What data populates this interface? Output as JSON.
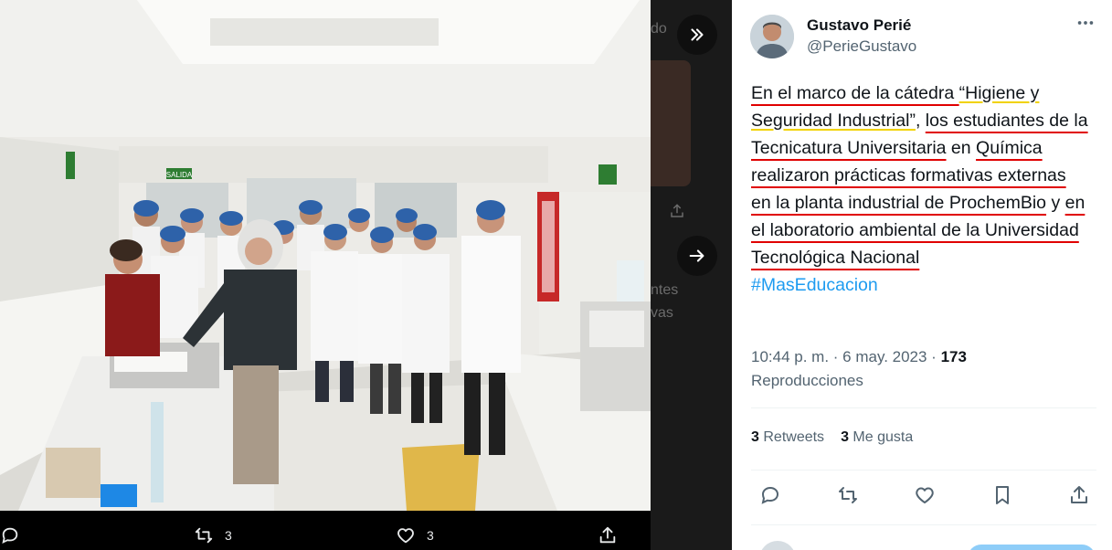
{
  "background_tweet": {
    "partial_text_1": "do",
    "partial_text_2": "ntes",
    "partial_text_3": "vas"
  },
  "media": {
    "photo_signs": {
      "exit": "SALIDA"
    },
    "actions": {
      "reply_count": "",
      "retweet_count": "3",
      "like_count": "3"
    }
  },
  "tweet": {
    "author_name": "Gustavo Perié",
    "author_handle": "@PerieGustavo",
    "text_segments": {
      "s1": "En el marco de la cátedra ",
      "s2": "“Higiene y Seguridad Industrial”",
      "s3": ", ",
      "s4": "los estudiantes de la Tecnicatura Universitaria",
      "s5": " en ",
      "s6": "Química realizaron prácticas formativas externas en la planta industrial de ProchemBio",
      "s7": " y ",
      "s8": "en el laboratorio ambiental de la Universidad Tecnológica Nacional",
      "hashtag": "#MasEducacion"
    },
    "timestamp": "10:44 p. m. · 6 may. 2023 · ",
    "views_count": "173",
    "views_label": "Reproducciones",
    "retweets_count": "3",
    "retweets_label": "Retweets",
    "likes_count": "3",
    "likes_label": "Me gusta"
  },
  "colors": {
    "accent": "#1d9bf0",
    "underline_red": "#e00000",
    "underline_yellow": "#f1d200",
    "text_primary": "#0f1419",
    "text_secondary": "#536471"
  },
  "icons": [
    "chevrons-right-icon",
    "arrow-right-icon",
    "reply-icon",
    "retweet-icon",
    "like-icon",
    "bookmark-icon",
    "share-icon",
    "more-icon"
  ]
}
